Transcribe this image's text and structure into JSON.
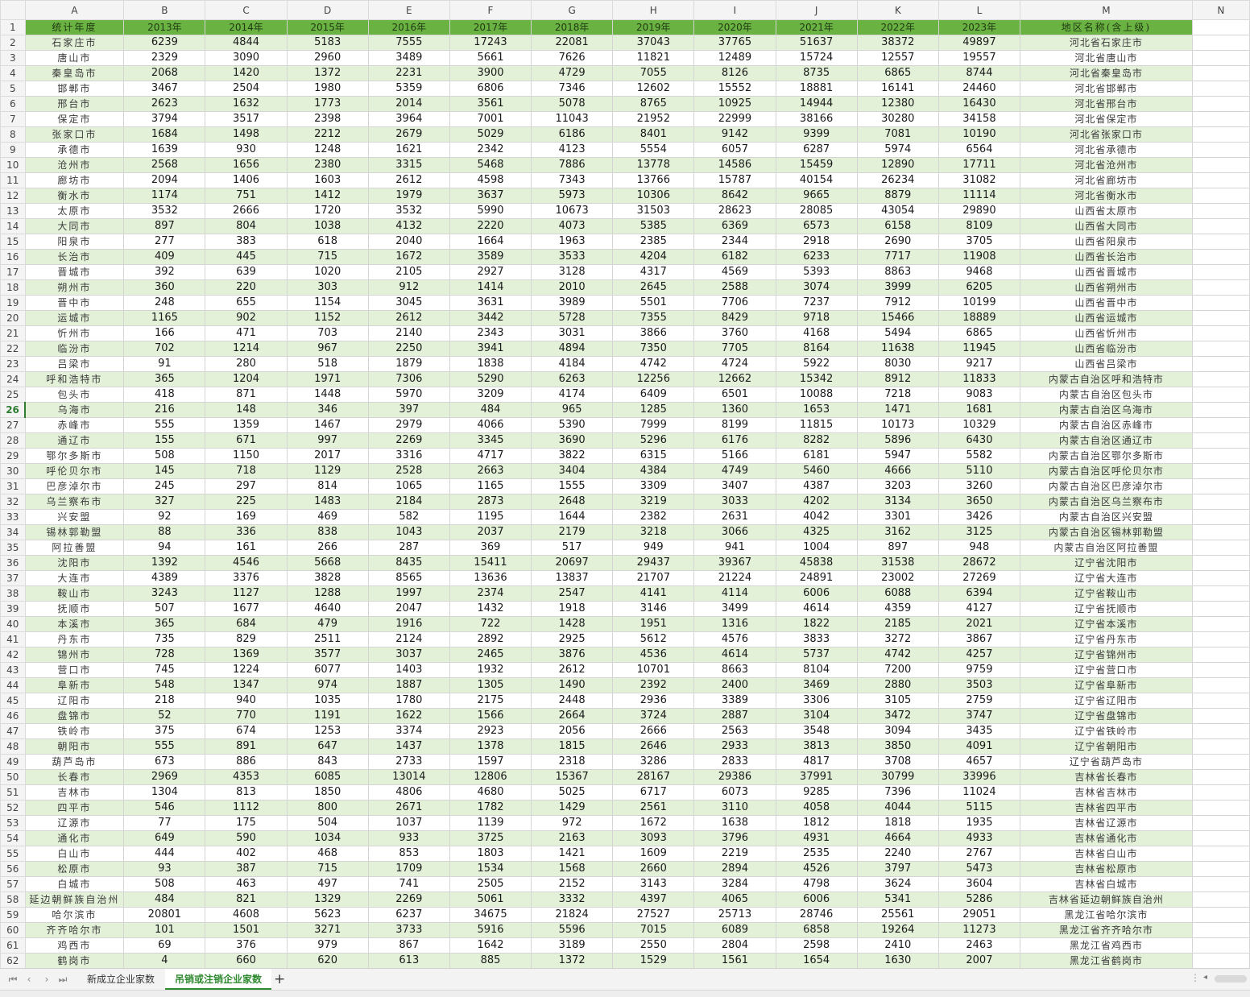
{
  "columns": [
    "A",
    "B",
    "C",
    "D",
    "E",
    "F",
    "G",
    "H",
    "I",
    "J",
    "K",
    "L",
    "M",
    "N"
  ],
  "header": [
    "统计年度",
    "2013年",
    "2014年",
    "2015年",
    "2016年",
    "2017年",
    "2018年",
    "2019年",
    "2020年",
    "2021年",
    "2022年",
    "2023年",
    "地区名称(含上级)"
  ],
  "rows": [
    [
      "石家庄市",
      "6239",
      "4844",
      "5183",
      "7555",
      "17243",
      "22081",
      "37043",
      "37765",
      "51637",
      "38372",
      "49897",
      "河北省石家庄市"
    ],
    [
      "唐山市",
      "2329",
      "3090",
      "2960",
      "3489",
      "5661",
      "7626",
      "11821",
      "12489",
      "15724",
      "12557",
      "19557",
      "河北省唐山市"
    ],
    [
      "秦皇岛市",
      "2068",
      "1420",
      "1372",
      "2231",
      "3900",
      "4729",
      "7055",
      "8126",
      "8735",
      "6865",
      "8744",
      "河北省秦皇岛市"
    ],
    [
      "邯郸市",
      "3467",
      "2504",
      "1980",
      "5359",
      "6806",
      "7346",
      "12602",
      "15552",
      "18881",
      "16141",
      "24460",
      "河北省邯郸市"
    ],
    [
      "邢台市",
      "2623",
      "1632",
      "1773",
      "2014",
      "3561",
      "5078",
      "8765",
      "10925",
      "14944",
      "12380",
      "16430",
      "河北省邢台市"
    ],
    [
      "保定市",
      "3794",
      "3517",
      "2398",
      "3964",
      "7001",
      "11043",
      "21952",
      "22999",
      "38166",
      "30280",
      "34158",
      "河北省保定市"
    ],
    [
      "张家口市",
      "1684",
      "1498",
      "2212",
      "2679",
      "5029",
      "6186",
      "8401",
      "9142",
      "9399",
      "7081",
      "10190",
      "河北省张家口市"
    ],
    [
      "承德市",
      "1639",
      "930",
      "1248",
      "1621",
      "2342",
      "4123",
      "5554",
      "6057",
      "6287",
      "5974",
      "6564",
      "河北省承德市"
    ],
    [
      "沧州市",
      "2568",
      "1656",
      "2380",
      "3315",
      "5468",
      "7886",
      "13778",
      "14586",
      "15459",
      "12890",
      "17711",
      "河北省沧州市"
    ],
    [
      "廊坊市",
      "2094",
      "1406",
      "1603",
      "2612",
      "4598",
      "7343",
      "13766",
      "15787",
      "40154",
      "26234",
      "31082",
      "河北省廊坊市"
    ],
    [
      "衡水市",
      "1174",
      "751",
      "1412",
      "1979",
      "3637",
      "5973",
      "10306",
      "8642",
      "9665",
      "8879",
      "11114",
      "河北省衡水市"
    ],
    [
      "太原市",
      "3532",
      "2666",
      "1720",
      "3532",
      "5990",
      "10673",
      "31503",
      "28623",
      "28085",
      "43054",
      "29890",
      "山西省太原市"
    ],
    [
      "大同市",
      "897",
      "804",
      "1038",
      "4132",
      "2220",
      "4073",
      "5385",
      "6369",
      "6573",
      "6158",
      "8109",
      "山西省大同市"
    ],
    [
      "阳泉市",
      "277",
      "383",
      "618",
      "2040",
      "1664",
      "1963",
      "2385",
      "2344",
      "2918",
      "2690",
      "3705",
      "山西省阳泉市"
    ],
    [
      "长治市",
      "409",
      "445",
      "715",
      "1672",
      "3589",
      "3533",
      "4204",
      "6182",
      "6233",
      "7717",
      "11908",
      "山西省长治市"
    ],
    [
      "晋城市",
      "392",
      "639",
      "1020",
      "2105",
      "2927",
      "3128",
      "4317",
      "4569",
      "5393",
      "8863",
      "9468",
      "山西省晋城市"
    ],
    [
      "朔州市",
      "360",
      "220",
      "303",
      "912",
      "1414",
      "2010",
      "2645",
      "2588",
      "3074",
      "3999",
      "6205",
      "山西省朔州市"
    ],
    [
      "晋中市",
      "248",
      "655",
      "1154",
      "3045",
      "3631",
      "3989",
      "5501",
      "7706",
      "7237",
      "7912",
      "10199",
      "山西省晋中市"
    ],
    [
      "运城市",
      "1165",
      "902",
      "1152",
      "2612",
      "3442",
      "5728",
      "7355",
      "8429",
      "9718",
      "15466",
      "18889",
      "山西省运城市"
    ],
    [
      "忻州市",
      "166",
      "471",
      "703",
      "2140",
      "2343",
      "3031",
      "3866",
      "3760",
      "4168",
      "5494",
      "6865",
      "山西省忻州市"
    ],
    [
      "临汾市",
      "702",
      "1214",
      "967",
      "2250",
      "3941",
      "4894",
      "7350",
      "7705",
      "8164",
      "11638",
      "11945",
      "山西省临汾市"
    ],
    [
      "吕梁市",
      "91",
      "280",
      "518",
      "1879",
      "1838",
      "4184",
      "4742",
      "4724",
      "5922",
      "8030",
      "9217",
      "山西省吕梁市"
    ],
    [
      "呼和浩特市",
      "365",
      "1204",
      "1971",
      "7306",
      "5290",
      "6263",
      "12256",
      "12662",
      "15342",
      "8912",
      "11833",
      "内蒙古自治区呼和浩特市"
    ],
    [
      "包头市",
      "418",
      "871",
      "1448",
      "5970",
      "3209",
      "4174",
      "6409",
      "6501",
      "10088",
      "7218",
      "9083",
      "内蒙古自治区包头市"
    ],
    [
      "乌海市",
      "216",
      "148",
      "346",
      "397",
      "484",
      "965",
      "1285",
      "1360",
      "1653",
      "1471",
      "1681",
      "内蒙古自治区乌海市"
    ],
    [
      "赤峰市",
      "555",
      "1359",
      "1467",
      "2979",
      "4066",
      "5390",
      "7999",
      "8199",
      "11815",
      "10173",
      "10329",
      "内蒙古自治区赤峰市"
    ],
    [
      "通辽市",
      "155",
      "671",
      "997",
      "2269",
      "3345",
      "3690",
      "5296",
      "6176",
      "8282",
      "5896",
      "6430",
      "内蒙古自治区通辽市"
    ],
    [
      "鄂尔多斯市",
      "508",
      "1150",
      "2017",
      "3316",
      "4717",
      "3822",
      "6315",
      "5166",
      "6181",
      "5947",
      "5582",
      "内蒙古自治区鄂尔多斯市"
    ],
    [
      "呼伦贝尔市",
      "145",
      "718",
      "1129",
      "2528",
      "2663",
      "3404",
      "4384",
      "4749",
      "5460",
      "4666",
      "5110",
      "内蒙古自治区呼伦贝尔市"
    ],
    [
      "巴彦淖尔市",
      "245",
      "297",
      "814",
      "1065",
      "1165",
      "1555",
      "3309",
      "3407",
      "4387",
      "3203",
      "3260",
      "内蒙古自治区巴彦淖尔市"
    ],
    [
      "乌兰察布市",
      "327",
      "225",
      "1483",
      "2184",
      "2873",
      "2648",
      "3219",
      "3033",
      "4202",
      "3134",
      "3650",
      "内蒙古自治区乌兰察布市"
    ],
    [
      "兴安盟",
      "92",
      "169",
      "469",
      "582",
      "1195",
      "1644",
      "2382",
      "2631",
      "4042",
      "3301",
      "3426",
      "内蒙古自治区兴安盟"
    ],
    [
      "锡林郭勒盟",
      "88",
      "336",
      "838",
      "1043",
      "2037",
      "2179",
      "3218",
      "3066",
      "4325",
      "3162",
      "3125",
      "内蒙古自治区锡林郭勒盟"
    ],
    [
      "阿拉善盟",
      "94",
      "161",
      "266",
      "287",
      "369",
      "517",
      "949",
      "941",
      "1004",
      "897",
      "948",
      "内蒙古自治区阿拉善盟"
    ],
    [
      "沈阳市",
      "1392",
      "4546",
      "5668",
      "8435",
      "15411",
      "20697",
      "29437",
      "39367",
      "45838",
      "31538",
      "28672",
      "辽宁省沈阳市"
    ],
    [
      "大连市",
      "4389",
      "3376",
      "3828",
      "8565",
      "13636",
      "13837",
      "21707",
      "21224",
      "24891",
      "23002",
      "27269",
      "辽宁省大连市"
    ],
    [
      "鞍山市",
      "3243",
      "1127",
      "1288",
      "1997",
      "2374",
      "2547",
      "4141",
      "4114",
      "6006",
      "6088",
      "6394",
      "辽宁省鞍山市"
    ],
    [
      "抚顺市",
      "507",
      "1677",
      "4640",
      "2047",
      "1432",
      "1918",
      "3146",
      "3499",
      "4614",
      "4359",
      "4127",
      "辽宁省抚顺市"
    ],
    [
      "本溪市",
      "365",
      "684",
      "479",
      "1916",
      "722",
      "1428",
      "1951",
      "1316",
      "1822",
      "2185",
      "2021",
      "辽宁省本溪市"
    ],
    [
      "丹东市",
      "735",
      "829",
      "2511",
      "2124",
      "2892",
      "2925",
      "5612",
      "4576",
      "3833",
      "3272",
      "3867",
      "辽宁省丹东市"
    ],
    [
      "锦州市",
      "728",
      "1369",
      "3577",
      "3037",
      "2465",
      "3876",
      "4536",
      "4614",
      "5737",
      "4742",
      "4257",
      "辽宁省锦州市"
    ],
    [
      "营口市",
      "745",
      "1224",
      "6077",
      "1403",
      "1932",
      "2612",
      "10701",
      "8663",
      "8104",
      "7200",
      "9759",
      "辽宁省营口市"
    ],
    [
      "阜新市",
      "548",
      "1347",
      "974",
      "1887",
      "1305",
      "1490",
      "2392",
      "2400",
      "3469",
      "2880",
      "3503",
      "辽宁省阜新市"
    ],
    [
      "辽阳市",
      "218",
      "940",
      "1035",
      "1780",
      "2175",
      "2448",
      "2936",
      "3389",
      "3306",
      "3105",
      "2759",
      "辽宁省辽阳市"
    ],
    [
      "盘锦市",
      "52",
      "770",
      "1191",
      "1622",
      "1566",
      "2664",
      "3724",
      "2887",
      "3104",
      "3472",
      "3747",
      "辽宁省盘锦市"
    ],
    [
      "铁岭市",
      "375",
      "674",
      "1253",
      "3374",
      "2923",
      "2056",
      "2666",
      "2563",
      "3548",
      "3094",
      "3435",
      "辽宁省铁岭市"
    ],
    [
      "朝阳市",
      "555",
      "891",
      "647",
      "1437",
      "1378",
      "1815",
      "2646",
      "2933",
      "3813",
      "3850",
      "4091",
      "辽宁省朝阳市"
    ],
    [
      "葫芦岛市",
      "673",
      "886",
      "843",
      "2733",
      "1597",
      "2318",
      "3286",
      "2833",
      "4817",
      "3708",
      "4657",
      "辽宁省葫芦岛市"
    ],
    [
      "长春市",
      "2969",
      "4353",
      "6085",
      "13014",
      "12806",
      "15367",
      "28167",
      "29386",
      "37991",
      "30799",
      "33996",
      "吉林省长春市"
    ],
    [
      "吉林市",
      "1304",
      "813",
      "1850",
      "4806",
      "4680",
      "5025",
      "6717",
      "6073",
      "9285",
      "7396",
      "11024",
      "吉林省吉林市"
    ],
    [
      "四平市",
      "546",
      "1112",
      "800",
      "2671",
      "1782",
      "1429",
      "2561",
      "3110",
      "4058",
      "4044",
      "5115",
      "吉林省四平市"
    ],
    [
      "辽源市",
      "77",
      "175",
      "504",
      "1037",
      "1139",
      "972",
      "1672",
      "1638",
      "1812",
      "1818",
      "1935",
      "吉林省辽源市"
    ],
    [
      "通化市",
      "649",
      "590",
      "1034",
      "933",
      "3725",
      "2163",
      "3093",
      "3796",
      "4931",
      "4664",
      "4933",
      "吉林省通化市"
    ],
    [
      "白山市",
      "444",
      "402",
      "468",
      "853",
      "1803",
      "1421",
      "1609",
      "2219",
      "2535",
      "2240",
      "2767",
      "吉林省白山市"
    ],
    [
      "松原市",
      "93",
      "387",
      "715",
      "1709",
      "1534",
      "1568",
      "2660",
      "2894",
      "4526",
      "3797",
      "5473",
      "吉林省松原市"
    ],
    [
      "白城市",
      "508",
      "463",
      "497",
      "741",
      "2505",
      "2152",
      "3143",
      "3284",
      "4798",
      "3624",
      "3604",
      "吉林省白城市"
    ],
    [
      "延边朝鲜族自治州",
      "484",
      "821",
      "1329",
      "2269",
      "5061",
      "3332",
      "4397",
      "4065",
      "6006",
      "5341",
      "5286",
      "吉林省延边朝鲜族自治州"
    ],
    [
      "哈尔滨市",
      "20801",
      "4608",
      "5623",
      "6237",
      "34675",
      "21824",
      "27527",
      "25713",
      "28746",
      "25561",
      "29051",
      "黑龙江省哈尔滨市"
    ],
    [
      "齐齐哈尔市",
      "101",
      "1501",
      "3271",
      "3733",
      "5916",
      "5596",
      "7015",
      "6089",
      "6858",
      "19264",
      "11273",
      "黑龙江省齐齐哈尔市"
    ],
    [
      "鸡西市",
      "69",
      "376",
      "979",
      "867",
      "1642",
      "3189",
      "2550",
      "2804",
      "2598",
      "2410",
      "2463",
      "黑龙江省鸡西市"
    ],
    [
      "鹤岗市",
      "4",
      "660",
      "620",
      "613",
      "885",
      "1372",
      "1529",
      "1561",
      "1654",
      "1630",
      "2007",
      "黑龙江省鹤岗市"
    ]
  ],
  "sheet_tabs": [
    "新成立企业家数",
    "吊销或注销企业家数"
  ],
  "active_tab": 1,
  "selected_row": 26,
  "colors": {
    "header_fill": "#6ab241",
    "band_fill": "#e4f1d9",
    "active_tab": "#2f8a2f"
  }
}
